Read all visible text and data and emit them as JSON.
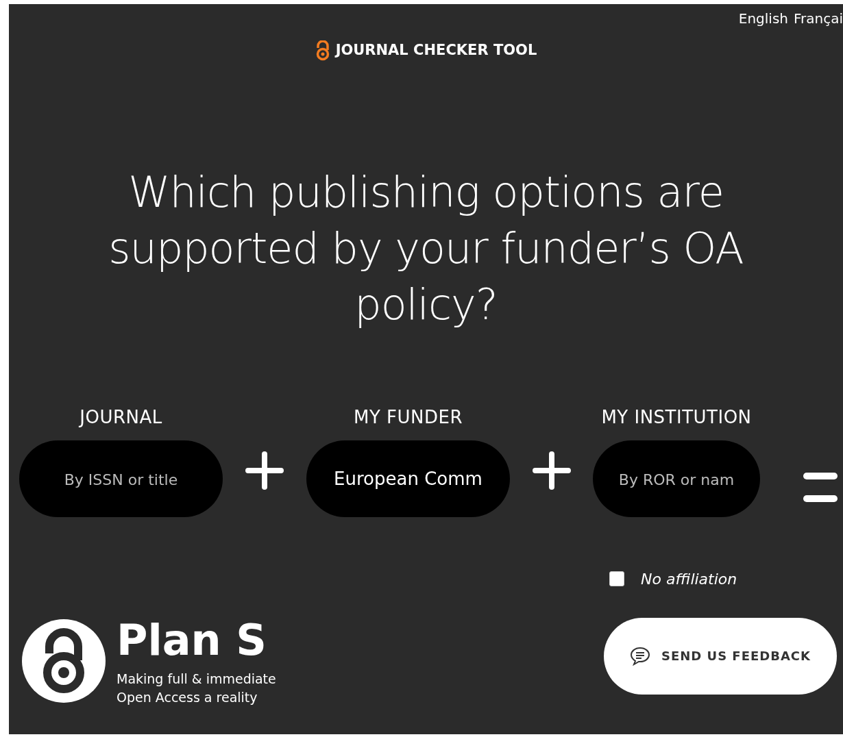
{
  "languages": [
    {
      "label": "English"
    },
    {
      "label": "Françai"
    }
  ],
  "app_title": "JOURNAL CHECKER TOOL",
  "headline": "Which publishing options are supported by your funder’s OA policy?",
  "fields": [
    {
      "label": "JOURNAL",
      "placeholder": "By ISSN or title"
    },
    {
      "label": "MY FUNDER",
      "value": "European Comm"
    },
    {
      "label": "MY INSTITUTION",
      "placeholder": "By ROR or nam"
    }
  ],
  "no_affiliation": {
    "label": "No affiliation",
    "checked": false
  },
  "brand": {
    "name": "Plan S",
    "tagline_lines": [
      "Making full & immediate",
      "Open Access a reality"
    ]
  },
  "feedback_button": "SEND US FEEDBACK"
}
